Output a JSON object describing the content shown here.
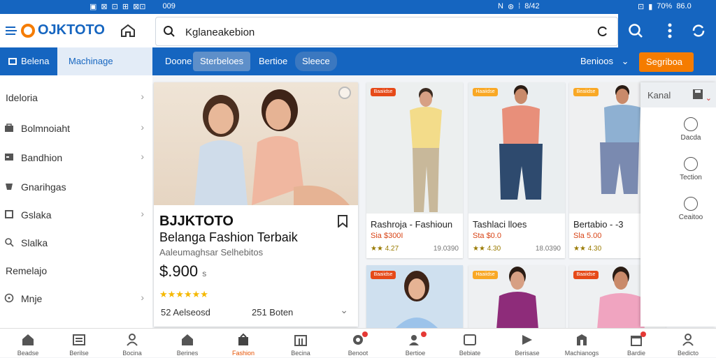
{
  "status": {
    "left": [
      "▣",
      "⊠",
      "⊡",
      "⊞",
      "⊠⊡"
    ],
    "center_left": "009",
    "mid_icons": [
      "N",
      "⊛",
      "⁞",
      "8/42"
    ],
    "right": [
      "⊡",
      "▮",
      "70%",
      "86.0"
    ]
  },
  "header": {
    "logo_text": "OJKTOTO",
    "search": {
      "value": "Kglaneakebion",
      "placeholder": ""
    }
  },
  "nav": {
    "left_tab1": "Belena",
    "left_tab2": "Machinage",
    "tabs": [
      "Doone",
      "Sterbeloes",
      "Bertioe",
      "Sleece"
    ],
    "right_select": "Benioos",
    "cta": "Segriboa"
  },
  "sidebar": {
    "items": [
      {
        "label": "Ideloria",
        "icon": "none-icon",
        "chevron": true
      },
      {
        "label": "Bolmnoiaht",
        "icon": "bag-icon",
        "chevron": true
      },
      {
        "label": "Bandhion",
        "icon": "card-icon",
        "chevron": true
      },
      {
        "label": "Gnarihgas",
        "icon": "cup-icon",
        "chevron": false
      },
      {
        "label": "Gslaka",
        "icon": "box-icon",
        "chevron": true
      },
      {
        "label": "Slalka",
        "icon": "search-icon",
        "chevron": false
      },
      {
        "label": "Remelajo",
        "icon": "none-icon",
        "chevron": false
      },
      {
        "label": "Mnje",
        "icon": "clock-icon",
        "chevron": true
      }
    ]
  },
  "hero": {
    "brand": "BJJKTOTO",
    "tagline": "Belanga Fashion Terbaik",
    "sub": "Aaleumaghsar Selhebitos",
    "price": "$.900",
    "price_suffix": "s",
    "stars": "★★★★★★",
    "foot1": "52 Aelseosd",
    "foot2": "251 Boten"
  },
  "products": [
    {
      "badge": "Baaiidse",
      "badge_color": "#e64a19",
      "title": "Rashroja - Fashioun",
      "price": "Sia $300I",
      "stars": "★★ 4.27",
      "sold": "19.0390",
      "shirt": "#f3dc8a",
      "pants": "#c8b89a",
      "bg": "#ecefef"
    },
    {
      "badge": "Haaiidse",
      "badge_color": "#f9a825",
      "title": "Tashlaci lloes",
      "price": "Sta $0.0",
      "stars": "★★ 4.30",
      "sold": "18.0390",
      "shirt": "#e88f7a",
      "pants": "#2e4a6e",
      "bg": "#eaeef0"
    },
    {
      "badge": "Beaiidse",
      "badge_color": "#f9a825",
      "title": "Bertabio - -3",
      "price": "Sla 5.00",
      "stars": "★★ 4.30",
      "sold": "",
      "shirt": "#8eb0d2",
      "pants": "#7a8ab0",
      "bg": "#eff0f1"
    }
  ],
  "products_row2": [
    {
      "badge": "Baaiidse",
      "badge_color": "#e64a19",
      "shirt": "#9cc3ea",
      "bg": "#cfe0ef"
    },
    {
      "badge": "Haaiidse",
      "badge_color": "#f9a825",
      "shirt": "#8e2c7a",
      "bg": "#eef0f2"
    },
    {
      "badge": "Baaiidse",
      "badge_color": "#e64a19",
      "shirt": "#f0a4c0",
      "bg": "#eef0f2"
    }
  ],
  "panel": {
    "title": "Kanal",
    "items": [
      "Dacda",
      "Tection",
      "Ceaitoo"
    ]
  },
  "bottom": {
    "items": [
      {
        "label": "Beadse",
        "icon": "home-icon",
        "active": false,
        "dot": false
      },
      {
        "label": "Berilse",
        "icon": "list-icon",
        "active": false,
        "dot": false
      },
      {
        "label": "Bocina",
        "icon": "user-icon",
        "active": false,
        "dot": false
      },
      {
        "label": "Berines",
        "icon": "home-icon",
        "active": false,
        "dot": false
      },
      {
        "label": "Fashion",
        "icon": "bag-icon",
        "active": true,
        "dot": false
      },
      {
        "label": "Becina",
        "icon": "shop-icon",
        "active": false,
        "dot": false
      },
      {
        "label": "Benoot",
        "icon": "settings-icon",
        "active": false,
        "dot": true
      },
      {
        "label": "Bertioe",
        "icon": "people-icon",
        "active": false,
        "dot": true
      },
      {
        "label": "Bebiate",
        "icon": "card-icon",
        "active": false,
        "dot": false
      },
      {
        "label": "Berisase",
        "icon": "play-icon",
        "active": false,
        "dot": false
      },
      {
        "label": "Machianogs",
        "icon": "building-icon",
        "active": false,
        "dot": false
      },
      {
        "label": "Bardie",
        "icon": "gift-icon",
        "active": false,
        "dot": true
      },
      {
        "label": "Bedicto",
        "icon": "user-icon",
        "active": false,
        "dot": false
      }
    ]
  }
}
